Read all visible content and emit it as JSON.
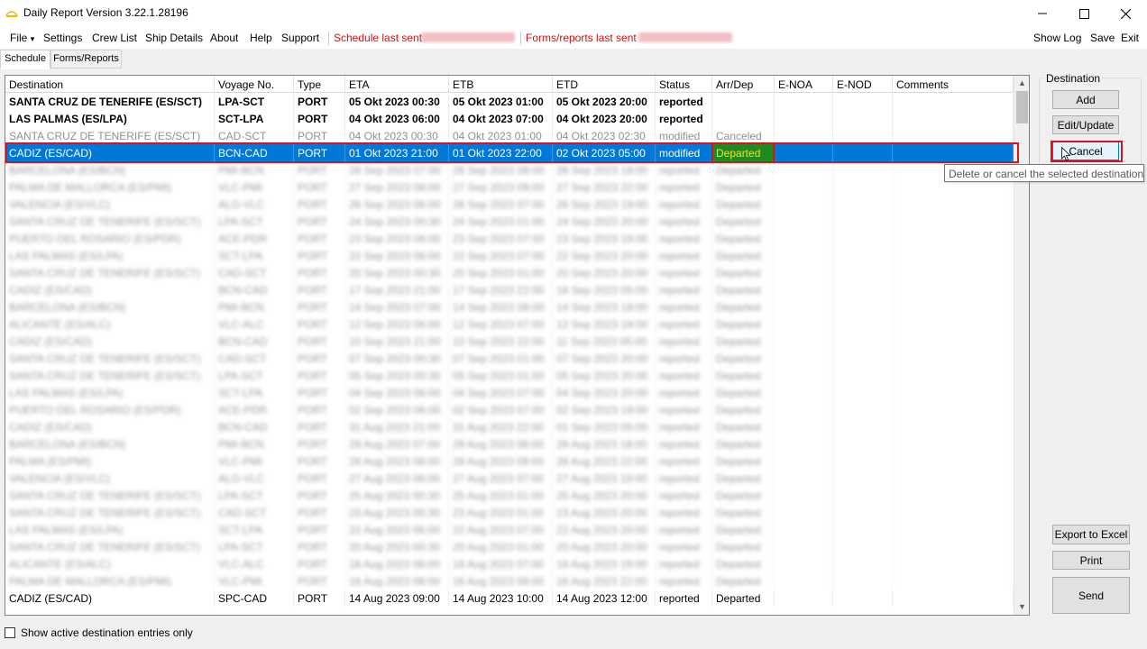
{
  "window": {
    "title": "Daily Report Version 3.22.1.28196",
    "controls": {
      "minimize": "─",
      "maximize": "☐",
      "close": "✕"
    }
  },
  "menu": {
    "file": "File",
    "file_arrow": "▾",
    "settings": "Settings",
    "crew_list": "Crew List",
    "ship_details": "Ship Details",
    "about": "About",
    "help": "Help",
    "support": "Support",
    "schedule_last_sent": "Schedule last sent",
    "forms_reports_last_sent": "Forms/reports last sent",
    "show_log": "Show Log",
    "save": "Save",
    "exit": "Exit"
  },
  "tabs": [
    "Schedule",
    "Forms/Reports"
  ],
  "grid": {
    "headers": [
      "Destination",
      "Voyage No.",
      "Type",
      "ETA",
      "ETB",
      "ETD",
      "Status",
      "Arr/Dep",
      "E-NOA",
      "E-NOD",
      "Comments"
    ],
    "rows": [
      {
        "style": "bold",
        "cells": [
          "SANTA CRUZ DE TENERIFE (ES/SCT)",
          "LPA-SCT",
          "PORT",
          "05 Okt 2023 00:30",
          "05 Okt 2023 01:00",
          "05 Okt 2023 20:00",
          "reported",
          "",
          "",
          "",
          ""
        ]
      },
      {
        "style": "bold",
        "cells": [
          "LAS PALMAS (ES/LPA)",
          "SCT-LPA",
          "PORT",
          "04 Okt 2023 06:00",
          "04 Okt 2023 07:00",
          "04 Okt 2023 20:00",
          "reported",
          "",
          "",
          "",
          ""
        ]
      },
      {
        "style": "grey",
        "cells": [
          "SANTA CRUZ DE TENERIFE (ES/SCT)",
          "CAD-SCT",
          "PORT",
          "04 Okt 2023 00:30",
          "04 Okt 2023 01:00",
          "04 Okt 2023 02:30",
          "modified",
          "Canceled",
          "",
          "",
          ""
        ]
      },
      {
        "style": "selected",
        "cells": [
          "CADIZ (ES/CAD)",
          "BCN-CAD",
          "PORT",
          "01 Okt 2023 21:00",
          "01 Okt 2023 22:00",
          "02 Okt 2023 05:00",
          "modified",
          "Departed",
          "",
          "",
          ""
        ]
      },
      {
        "style": "blur",
        "cells": [
          "BARCELONA (ES/BCN)",
          "PMI-BCN",
          "PORT",
          "28 Sep 2023 07:00",
          "28 Sep 2023 08:00",
          "28 Sep 2023 18:00",
          "reported",
          "Departed",
          "",
          "",
          ""
        ]
      },
      {
        "style": "blur",
        "cells": [
          "PALMA DE MALLORCA (ES/PMI)",
          "VLC-PMI",
          "PORT",
          "27 Sep 2023 08:00",
          "27 Sep 2023 09:00",
          "27 Sep 2023 22:00",
          "reported",
          "Departed",
          "",
          "",
          ""
        ]
      },
      {
        "style": "blur",
        "cells": [
          "VALENCIA (ES/VLC)",
          "ALG-VLC",
          "PORT",
          "26 Sep 2023 06:00",
          "26 Sep 2023 07:00",
          "26 Sep 2023 19:00",
          "reported",
          "Departed",
          "",
          "",
          ""
        ]
      },
      {
        "style": "blur",
        "cells": [
          "SANTA CRUZ DE TENERIFE (ES/SCT)",
          "LPA-SCT",
          "PORT",
          "24 Sep 2023 00:30",
          "24 Sep 2023 01:00",
          "24 Sep 2023 20:00",
          "reported",
          "Departed",
          "",
          "",
          ""
        ]
      },
      {
        "style": "blur",
        "cells": [
          "PUERTO DEL ROSARIO (ES/PDR)",
          "ACE-PDR",
          "PORT",
          "23 Sep 2023 06:00",
          "23 Sep 2023 07:00",
          "23 Sep 2023 19:00",
          "reported",
          "Departed",
          "",
          "",
          ""
        ]
      },
      {
        "style": "blur",
        "cells": [
          "LAS PALMAS (ES/LPA)",
          "SCT-LPA",
          "PORT",
          "22 Sep 2023 06:00",
          "22 Sep 2023 07:00",
          "22 Sep 2023 20:00",
          "reported",
          "Departed",
          "",
          "",
          ""
        ]
      },
      {
        "style": "blur",
        "cells": [
          "SANTA CRUZ DE TENERIFE (ES/SCT)",
          "CAD-SCT",
          "PORT",
          "20 Sep 2023 00:30",
          "20 Sep 2023 01:00",
          "20 Sep 2023 20:00",
          "reported",
          "Departed",
          "",
          "",
          ""
        ]
      },
      {
        "style": "blur",
        "cells": [
          "CADIZ (ES/CAD)",
          "BCN-CAD",
          "PORT",
          "17 Sep 2023 21:00",
          "17 Sep 2023 22:00",
          "18 Sep 2023 05:00",
          "reported",
          "Departed",
          "",
          "",
          ""
        ]
      },
      {
        "style": "blur",
        "cells": [
          "BARCELONA (ES/BCN)",
          "PMI-BCN",
          "PORT",
          "14 Sep 2023 07:00",
          "14 Sep 2023 08:00",
          "14 Sep 2023 18:00",
          "reported",
          "Departed",
          "",
          "",
          ""
        ]
      },
      {
        "style": "blur",
        "cells": [
          "ALICANTE (ES/ALC)",
          "VLC-ALC",
          "PORT",
          "12 Sep 2023 06:00",
          "12 Sep 2023 07:00",
          "12 Sep 2023 19:00",
          "reported",
          "Departed",
          "",
          "",
          ""
        ]
      },
      {
        "style": "blur",
        "cells": [
          "CADIZ (ES/CAD)",
          "BCN-CAD",
          "PORT",
          "10 Sep 2023 21:00",
          "10 Sep 2023 22:00",
          "11 Sep 2023 05:00",
          "reported",
          "Departed",
          "",
          "",
          ""
        ]
      },
      {
        "style": "blur",
        "cells": [
          "SANTA CRUZ DE TENERIFE (ES/SCT)",
          "CAD-SCT",
          "PORT",
          "07 Sep 2023 00:30",
          "07 Sep 2023 01:00",
          "07 Sep 2023 20:00",
          "reported",
          "Departed",
          "",
          "",
          ""
        ]
      },
      {
        "style": "blur",
        "cells": [
          "SANTA CRUZ DE TENERIFE (ES/SCT)",
          "LPA-SCT",
          "PORT",
          "05 Sep 2023 00:30",
          "05 Sep 2023 01:00",
          "05 Sep 2023 20:00",
          "reported",
          "Departed",
          "",
          "",
          ""
        ]
      },
      {
        "style": "blur",
        "cells": [
          "LAS PALMAS (ES/LPA)",
          "SCT-LPA",
          "PORT",
          "04 Sep 2023 06:00",
          "04 Sep 2023 07:00",
          "04 Sep 2023 20:00",
          "reported",
          "Departed",
          "",
          "",
          ""
        ]
      },
      {
        "style": "blur",
        "cells": [
          "PUERTO DEL ROSARIO (ES/PDR)",
          "ACE-PDR",
          "PORT",
          "02 Sep 2023 06:00",
          "02 Sep 2023 07:00",
          "02 Sep 2023 19:00",
          "reported",
          "Departed",
          "",
          "",
          ""
        ]
      },
      {
        "style": "blur",
        "cells": [
          "CADIZ (ES/CAD)",
          "BCN-CAD",
          "PORT",
          "31 Aug 2023 21:00",
          "31 Aug 2023 22:00",
          "01 Sep 2023 05:00",
          "reported",
          "Departed",
          "",
          "",
          ""
        ]
      },
      {
        "style": "blur",
        "cells": [
          "BARCELONA (ES/BCN)",
          "PMI-BCN",
          "PORT",
          "29 Aug 2023 07:00",
          "29 Aug 2023 08:00",
          "29 Aug 2023 18:00",
          "reported",
          "Departed",
          "",
          "",
          ""
        ]
      },
      {
        "style": "blur",
        "cells": [
          "PALMA (ES/PMI)",
          "VLC-PMI",
          "PORT",
          "28 Aug 2023 08:00",
          "28 Aug 2023 09:00",
          "28 Aug 2023 22:00",
          "reported",
          "Departed",
          "",
          "",
          ""
        ]
      },
      {
        "style": "blur",
        "cells": [
          "VALENCIA (ES/VLC)",
          "ALG-VLC",
          "PORT",
          "27 Aug 2023 06:00",
          "27 Aug 2023 07:00",
          "27 Aug 2023 19:00",
          "reported",
          "Departed",
          "",
          "",
          ""
        ]
      },
      {
        "style": "blur",
        "cells": [
          "SANTA CRUZ DE TENERIFE (ES/SCT)",
          "LPA-SCT",
          "PORT",
          "25 Aug 2023 00:30",
          "25 Aug 2023 01:00",
          "25 Aug 2023 20:00",
          "reported",
          "Departed",
          "",
          "",
          ""
        ]
      },
      {
        "style": "blur",
        "cells": [
          "SANTA CRUZ DE TENERIFE (ES/SCT)",
          "CAD-SCT",
          "PORT",
          "23 Aug 2023 00:30",
          "23 Aug 2023 01:00",
          "23 Aug 2023 20:00",
          "reported",
          "Departed",
          "",
          "",
          ""
        ]
      },
      {
        "style": "blur",
        "cells": [
          "LAS PALMAS (ES/LPA)",
          "SCT-LPA",
          "PORT",
          "22 Aug 2023 06:00",
          "22 Aug 2023 07:00",
          "22 Aug 2023 20:00",
          "reported",
          "Departed",
          "",
          "",
          ""
        ]
      },
      {
        "style": "blur",
        "cells": [
          "SANTA CRUZ DE TENERIFE (ES/SCT)",
          "LPA-SCT",
          "PORT",
          "20 Aug 2023 00:30",
          "20 Aug 2023 01:00",
          "20 Aug 2023 20:00",
          "reported",
          "Departed",
          "",
          "",
          ""
        ]
      },
      {
        "style": "blur",
        "cells": [
          "ALICANTE (ES/ALC)",
          "VLC-ALC",
          "PORT",
          "18 Aug 2023 06:00",
          "18 Aug 2023 07:00",
          "18 Aug 2023 19:00",
          "reported",
          "Departed",
          "",
          "",
          ""
        ]
      },
      {
        "style": "blur",
        "cells": [
          "PALMA DE MALLORCA (ES/PMI)",
          "VLC-PMI",
          "PORT",
          "16 Aug 2023 08:00",
          "16 Aug 2023 09:00",
          "16 Aug 2023 22:00",
          "reported",
          "Departed",
          "",
          "",
          ""
        ]
      },
      {
        "style": "partial",
        "cells": [
          "CADIZ (ES/CAD)",
          "SPC-CAD",
          "PORT",
          "14 Aug 2023 09:00",
          "14 Aug 2023 10:00",
          "14 Aug 2023 12:00",
          "reported",
          "Departed",
          "",
          "",
          ""
        ]
      }
    ],
    "scroll": {
      "up": "▲",
      "down": "▼"
    }
  },
  "destination_panel": {
    "legend": "Destination",
    "add": "Add",
    "edit_update": "Edit/Update",
    "cancel": "Cancel"
  },
  "tooltip": "Delete or cancel the selected destination",
  "actions": {
    "export": "Export to Excel",
    "print": "Print",
    "send": "Send"
  },
  "show_active_label": "Show active destination entries only",
  "colors": {
    "selection": "#0078d7",
    "departed_bg": "#1f8a1f",
    "highlight": "#e0101b",
    "menu_red": "#d01010"
  }
}
